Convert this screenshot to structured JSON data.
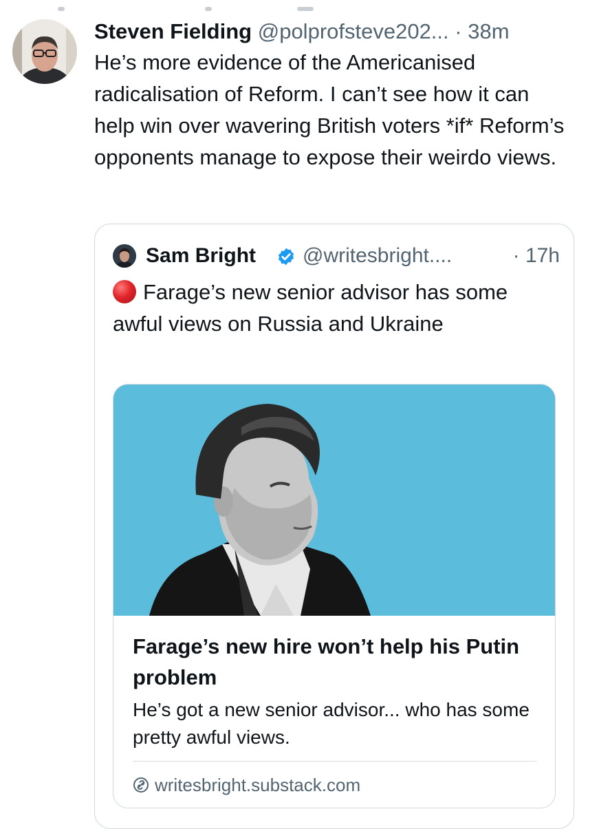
{
  "post": {
    "author_name": "Steven Fielding",
    "handle": "@polprofsteve202...",
    "separator": "·",
    "time": "38m",
    "text": "He’s more evidence of the Americanised radicalisation of Reform. I can’t see how it can help win over wavering British voters *if* Reform’s opponents manage to expose their weirdo views.",
    "avatar_icon": "profile-photo",
    "author_name_color": "#0f1419",
    "meta_color": "#536471"
  },
  "quote": {
    "author_name": "Sam Bright",
    "verified_icon": "verified-badge-icon",
    "verified_color": "#1d9bf0",
    "handle": "@writesbright....",
    "separator": "·",
    "time": "17h",
    "emoji_icon": "red-circle-emoji",
    "text": "Farage’s new senior advisor has some awful views on Russia and Ukraine",
    "border_color": "#cfd9de"
  },
  "link_card": {
    "image_background": "#5bbcdc",
    "image_description_icon": "article-photo",
    "title": "Farage’s new hire won’t help his Putin problem",
    "description": "He’s got a new senior advisor... who has some pretty awful views.",
    "domain_icon": "link-icon",
    "domain": "writesbright.substack.com"
  }
}
